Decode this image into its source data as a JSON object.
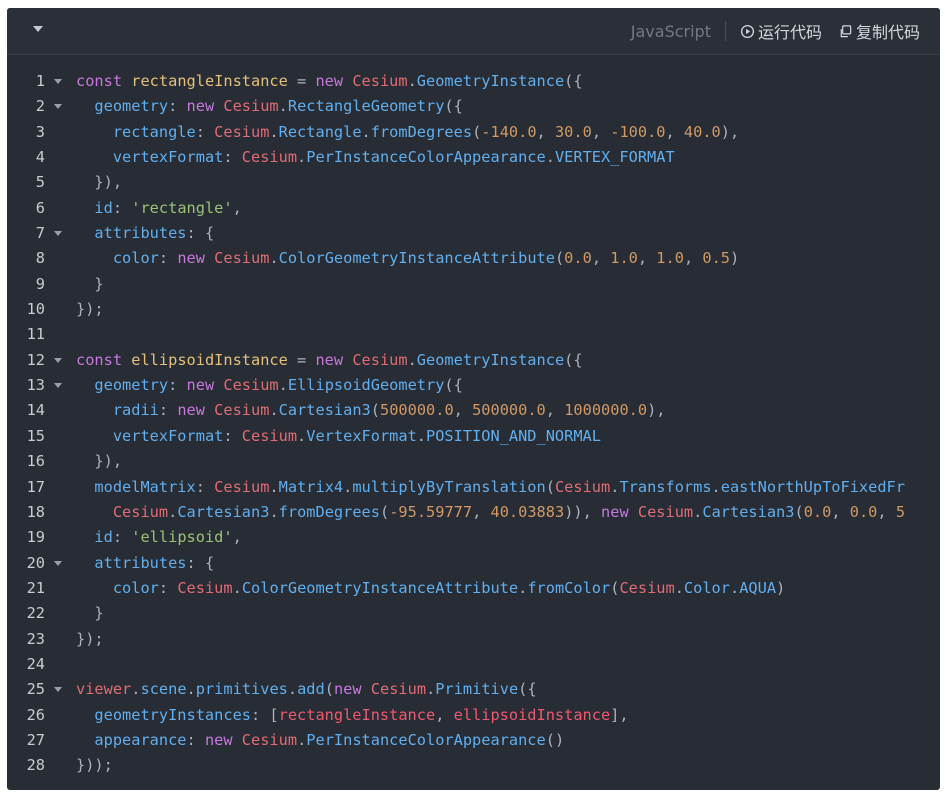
{
  "toolbar": {
    "language": "JavaScript",
    "run_label": "运行代码",
    "copy_label": "复制代码",
    "icons": {
      "collapse": "chevron-down-icon",
      "run": "play-circle-icon",
      "copy": "copy-icon"
    }
  },
  "theme": {
    "background": "#282c34",
    "keyword": "#c678dd",
    "variable": "#e5c07b",
    "namespace": "#e06c75",
    "function": "#61afef",
    "number": "#d19a66",
    "string": "#98c379"
  },
  "code": {
    "lines": [
      {
        "n": "1",
        "fold": true,
        "tokens": [
          [
            "kw",
            "const "
          ],
          [
            "va",
            "rectangleInstance"
          ],
          [
            "pn",
            " = "
          ],
          [
            "kw",
            "new "
          ],
          [
            "cs",
            "Cesium"
          ],
          [
            "pn",
            "."
          ],
          [
            "fn",
            "GeometryInstance"
          ],
          [
            "pn",
            "({"
          ]
        ]
      },
      {
        "n": "2",
        "fold": true,
        "tokens": [
          [
            "pn",
            "  "
          ],
          [
            "pr",
            "geometry"
          ],
          [
            "pn",
            ": "
          ],
          [
            "kw",
            "new "
          ],
          [
            "cs",
            "Cesium"
          ],
          [
            "pn",
            "."
          ],
          [
            "fn",
            "RectangleGeometry"
          ],
          [
            "pn",
            "({"
          ]
        ]
      },
      {
        "n": "3",
        "fold": false,
        "tokens": [
          [
            "pn",
            "    "
          ],
          [
            "pr",
            "rectangle"
          ],
          [
            "pn",
            ": "
          ],
          [
            "cs",
            "Cesium"
          ],
          [
            "pn",
            "."
          ],
          [
            "fn",
            "Rectangle"
          ],
          [
            "pn",
            "."
          ],
          [
            "fn",
            "fromDegrees"
          ],
          [
            "pn",
            "("
          ],
          [
            "nm",
            "-140.0"
          ],
          [
            "pn",
            ", "
          ],
          [
            "nm",
            "30.0"
          ],
          [
            "pn",
            ", "
          ],
          [
            "nm",
            "-100.0"
          ],
          [
            "pn",
            ", "
          ],
          [
            "nm",
            "40.0"
          ],
          [
            "pn",
            "),"
          ]
        ]
      },
      {
        "n": "4",
        "fold": false,
        "tokens": [
          [
            "pn",
            "    "
          ],
          [
            "pr",
            "vertexFormat"
          ],
          [
            "pn",
            ": "
          ],
          [
            "cs",
            "Cesium"
          ],
          [
            "pn",
            "."
          ],
          [
            "fn",
            "PerInstanceColorAppearance"
          ],
          [
            "pn",
            "."
          ],
          [
            "fn",
            "VERTEX_FORMAT"
          ]
        ]
      },
      {
        "n": "5",
        "fold": false,
        "tokens": [
          [
            "pn",
            "  }),"
          ]
        ]
      },
      {
        "n": "6",
        "fold": false,
        "tokens": [
          [
            "pn",
            "  "
          ],
          [
            "pr",
            "id"
          ],
          [
            "pn",
            ": "
          ],
          [
            "st",
            "'rectangle'"
          ],
          [
            "pn",
            ","
          ]
        ]
      },
      {
        "n": "7",
        "fold": true,
        "tokens": [
          [
            "pn",
            "  "
          ],
          [
            "pr",
            "attributes"
          ],
          [
            "pn",
            ": {"
          ]
        ]
      },
      {
        "n": "8",
        "fold": false,
        "tokens": [
          [
            "pn",
            "    "
          ],
          [
            "pr",
            "color"
          ],
          [
            "pn",
            ": "
          ],
          [
            "kw",
            "new "
          ],
          [
            "cs",
            "Cesium"
          ],
          [
            "pn",
            "."
          ],
          [
            "fn",
            "ColorGeometryInstanceAttribute"
          ],
          [
            "pn",
            "("
          ],
          [
            "nm",
            "0.0"
          ],
          [
            "pn",
            ", "
          ],
          [
            "nm",
            "1.0"
          ],
          [
            "pn",
            ", "
          ],
          [
            "nm",
            "1.0"
          ],
          [
            "pn",
            ", "
          ],
          [
            "nm",
            "0.5"
          ],
          [
            "pn",
            ")"
          ]
        ]
      },
      {
        "n": "9",
        "fold": false,
        "tokens": [
          [
            "pn",
            "  }"
          ]
        ]
      },
      {
        "n": "10",
        "fold": false,
        "tokens": [
          [
            "pn",
            "});"
          ]
        ]
      },
      {
        "n": "11",
        "fold": false,
        "tokens": []
      },
      {
        "n": "12",
        "fold": true,
        "tokens": [
          [
            "kw",
            "const "
          ],
          [
            "va",
            "ellipsoidInstance"
          ],
          [
            "pn",
            " = "
          ],
          [
            "kw",
            "new "
          ],
          [
            "cs",
            "Cesium"
          ],
          [
            "pn",
            "."
          ],
          [
            "fn",
            "GeometryInstance"
          ],
          [
            "pn",
            "({"
          ]
        ]
      },
      {
        "n": "13",
        "fold": true,
        "tokens": [
          [
            "pn",
            "  "
          ],
          [
            "pr",
            "geometry"
          ],
          [
            "pn",
            ": "
          ],
          [
            "kw",
            "new "
          ],
          [
            "cs",
            "Cesium"
          ],
          [
            "pn",
            "."
          ],
          [
            "fn",
            "EllipsoidGeometry"
          ],
          [
            "pn",
            "({"
          ]
        ]
      },
      {
        "n": "14",
        "fold": false,
        "tokens": [
          [
            "pn",
            "    "
          ],
          [
            "pr",
            "radii"
          ],
          [
            "pn",
            ": "
          ],
          [
            "kw",
            "new "
          ],
          [
            "cs",
            "Cesium"
          ],
          [
            "pn",
            "."
          ],
          [
            "fn",
            "Cartesian3"
          ],
          [
            "pn",
            "("
          ],
          [
            "nm",
            "500000.0"
          ],
          [
            "pn",
            ", "
          ],
          [
            "nm",
            "500000.0"
          ],
          [
            "pn",
            ", "
          ],
          [
            "nm",
            "1000000.0"
          ],
          [
            "pn",
            "),"
          ]
        ]
      },
      {
        "n": "15",
        "fold": false,
        "tokens": [
          [
            "pn",
            "    "
          ],
          [
            "pr",
            "vertexFormat"
          ],
          [
            "pn",
            ": "
          ],
          [
            "cs",
            "Cesium"
          ],
          [
            "pn",
            "."
          ],
          [
            "fn",
            "VertexFormat"
          ],
          [
            "pn",
            "."
          ],
          [
            "fn",
            "POSITION_AND_NORMAL"
          ]
        ]
      },
      {
        "n": "16",
        "fold": false,
        "tokens": [
          [
            "pn",
            "  }),"
          ]
        ]
      },
      {
        "n": "17",
        "fold": false,
        "tokens": [
          [
            "pn",
            "  "
          ],
          [
            "pr",
            "modelMatrix"
          ],
          [
            "pn",
            ": "
          ],
          [
            "cs",
            "Cesium"
          ],
          [
            "pn",
            "."
          ],
          [
            "fn",
            "Matrix4"
          ],
          [
            "pn",
            "."
          ],
          [
            "fn",
            "multiplyByTranslation"
          ],
          [
            "pn",
            "("
          ],
          [
            "cs",
            "Cesium"
          ],
          [
            "pn",
            "."
          ],
          [
            "fn",
            "Transforms"
          ],
          [
            "pn",
            "."
          ],
          [
            "fn",
            "eastNorthUpToFixedFr"
          ]
        ]
      },
      {
        "n": "18",
        "fold": false,
        "tokens": [
          [
            "pn",
            "    "
          ],
          [
            "cs",
            "Cesium"
          ],
          [
            "pn",
            "."
          ],
          [
            "fn",
            "Cartesian3"
          ],
          [
            "pn",
            "."
          ],
          [
            "fn",
            "fromDegrees"
          ],
          [
            "pn",
            "("
          ],
          [
            "nm",
            "-95.59777"
          ],
          [
            "pn",
            ", "
          ],
          [
            "nm",
            "40.03883"
          ],
          [
            "pn",
            ")), "
          ],
          [
            "kw",
            "new "
          ],
          [
            "cs",
            "Cesium"
          ],
          [
            "pn",
            "."
          ],
          [
            "fn",
            "Cartesian3"
          ],
          [
            "pn",
            "("
          ],
          [
            "nm",
            "0.0"
          ],
          [
            "pn",
            ", "
          ],
          [
            "nm",
            "0.0"
          ],
          [
            "pn",
            ", "
          ],
          [
            "nm",
            "5"
          ]
        ]
      },
      {
        "n": "19",
        "fold": false,
        "tokens": [
          [
            "pn",
            "  "
          ],
          [
            "pr",
            "id"
          ],
          [
            "pn",
            ": "
          ],
          [
            "st",
            "'ellipsoid'"
          ],
          [
            "pn",
            ","
          ]
        ]
      },
      {
        "n": "20",
        "fold": true,
        "tokens": [
          [
            "pn",
            "  "
          ],
          [
            "pr",
            "attributes"
          ],
          [
            "pn",
            ": {"
          ]
        ]
      },
      {
        "n": "21",
        "fold": false,
        "tokens": [
          [
            "pn",
            "    "
          ],
          [
            "pr",
            "color"
          ],
          [
            "pn",
            ": "
          ],
          [
            "cs",
            "Cesium"
          ],
          [
            "pn",
            "."
          ],
          [
            "fn",
            "ColorGeometryInstanceAttribute"
          ],
          [
            "pn",
            "."
          ],
          [
            "fn",
            "fromColor"
          ],
          [
            "pn",
            "("
          ],
          [
            "cs",
            "Cesium"
          ],
          [
            "pn",
            "."
          ],
          [
            "fn",
            "Color"
          ],
          [
            "pn",
            "."
          ],
          [
            "fn",
            "AQUA"
          ],
          [
            "pn",
            ")"
          ]
        ]
      },
      {
        "n": "22",
        "fold": false,
        "tokens": [
          [
            "pn",
            "  }"
          ]
        ]
      },
      {
        "n": "23",
        "fold": false,
        "tokens": [
          [
            "pn",
            "});"
          ]
        ]
      },
      {
        "n": "24",
        "fold": false,
        "tokens": []
      },
      {
        "n": "25",
        "fold": true,
        "tokens": [
          [
            "cs",
            "viewer"
          ],
          [
            "pn",
            "."
          ],
          [
            "fn",
            "scene"
          ],
          [
            "pn",
            "."
          ],
          [
            "fn",
            "primitives"
          ],
          [
            "pn",
            "."
          ],
          [
            "fn",
            "add"
          ],
          [
            "pn",
            "("
          ],
          [
            "kw",
            "new "
          ],
          [
            "cs",
            "Cesium"
          ],
          [
            "pn",
            "."
          ],
          [
            "fn",
            "Primitive"
          ],
          [
            "pn",
            "({"
          ]
        ]
      },
      {
        "n": "26",
        "fold": false,
        "tokens": [
          [
            "pn",
            "  "
          ],
          [
            "pr",
            "geometryInstances"
          ],
          [
            "pn",
            ": ["
          ],
          [
            "ac",
            "rectangleInstance"
          ],
          [
            "pn",
            ", "
          ],
          [
            "ac",
            "ellipsoidInstance"
          ],
          [
            "pn",
            "],"
          ]
        ]
      },
      {
        "n": "27",
        "fold": false,
        "tokens": [
          [
            "pn",
            "  "
          ],
          [
            "pr",
            "appearance"
          ],
          [
            "pn",
            ": "
          ],
          [
            "kw",
            "new "
          ],
          [
            "cs",
            "Cesium"
          ],
          [
            "pn",
            "."
          ],
          [
            "fn",
            "PerInstanceColorAppearance"
          ],
          [
            "pn",
            "()"
          ]
        ]
      },
      {
        "n": "28",
        "fold": false,
        "tokens": [
          [
            "pn",
            "}));"
          ]
        ]
      }
    ]
  }
}
